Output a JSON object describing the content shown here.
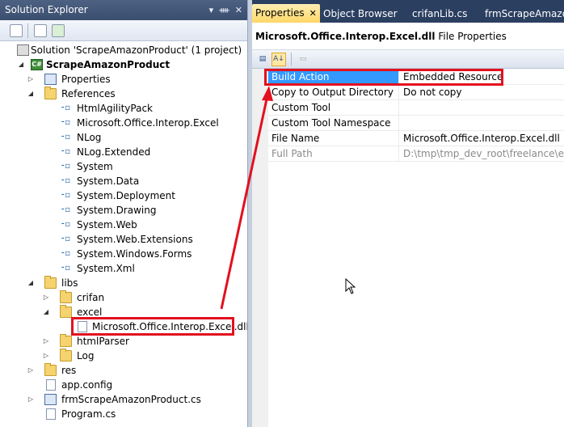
{
  "solution_explorer": {
    "title": "Solution Explorer",
    "title_buttons": [
      "▾",
      "ᚓ",
      "✕"
    ],
    "solution_label": "Solution 'ScrapeAmazonProduct' (1 project)",
    "project_label": "ScrapeAmazonProduct",
    "properties_label": "Properties",
    "references_label": "References",
    "references": [
      "HtmlAgilityPack",
      "Microsoft.Office.Interop.Excel",
      "NLog",
      "NLog.Extended",
      "System",
      "System.Data",
      "System.Deployment",
      "System.Drawing",
      "System.Web",
      "System.Web.Extensions",
      "System.Windows.Forms",
      "System.Xml"
    ],
    "libs_label": "libs",
    "crifan_label": "crifan",
    "excel_label": "excel",
    "excel_dll_label": "Microsoft.Office.Interop.Excel.dll",
    "htmlparser_label": "htmlParser",
    "log_label": "Log",
    "res_label": "res",
    "app_config_label": "app.config",
    "form_cs_label": "frmScrapeAmazonProduct.cs",
    "program_cs_label": "Program.cs"
  },
  "tabs": [
    {
      "label": "Properties",
      "active": true
    },
    {
      "label": "Object Browser",
      "active": false
    },
    {
      "label": "crifanLib.cs",
      "active": false
    },
    {
      "label": "frmScrapeAmazonProduct.cs",
      "active": false
    }
  ],
  "tab_close": "✕",
  "properties": {
    "object_name": "Microsoft.Office.Interop.Excel.dll",
    "object_type": "File Properties",
    "rows": [
      {
        "name": "Build Action",
        "value": "Embedded Resource"
      },
      {
        "name": "Copy to Output Directory",
        "value": "Do not copy"
      },
      {
        "name": "Custom Tool",
        "value": ""
      },
      {
        "name": "Custom Tool Namespace",
        "value": ""
      },
      {
        "name": "File Name",
        "value": "Microsoft.Office.Interop.Excel.dll"
      },
      {
        "name": "Full Path",
        "value": "D:\\tmp\\tmp_dev_root\\freelance\\elance"
      }
    ]
  },
  "colors": {
    "highlight": "#e3101f",
    "selected_row": "#3399ff",
    "active_tab": "#ffd767",
    "tab_bar": "#2b3f61"
  }
}
